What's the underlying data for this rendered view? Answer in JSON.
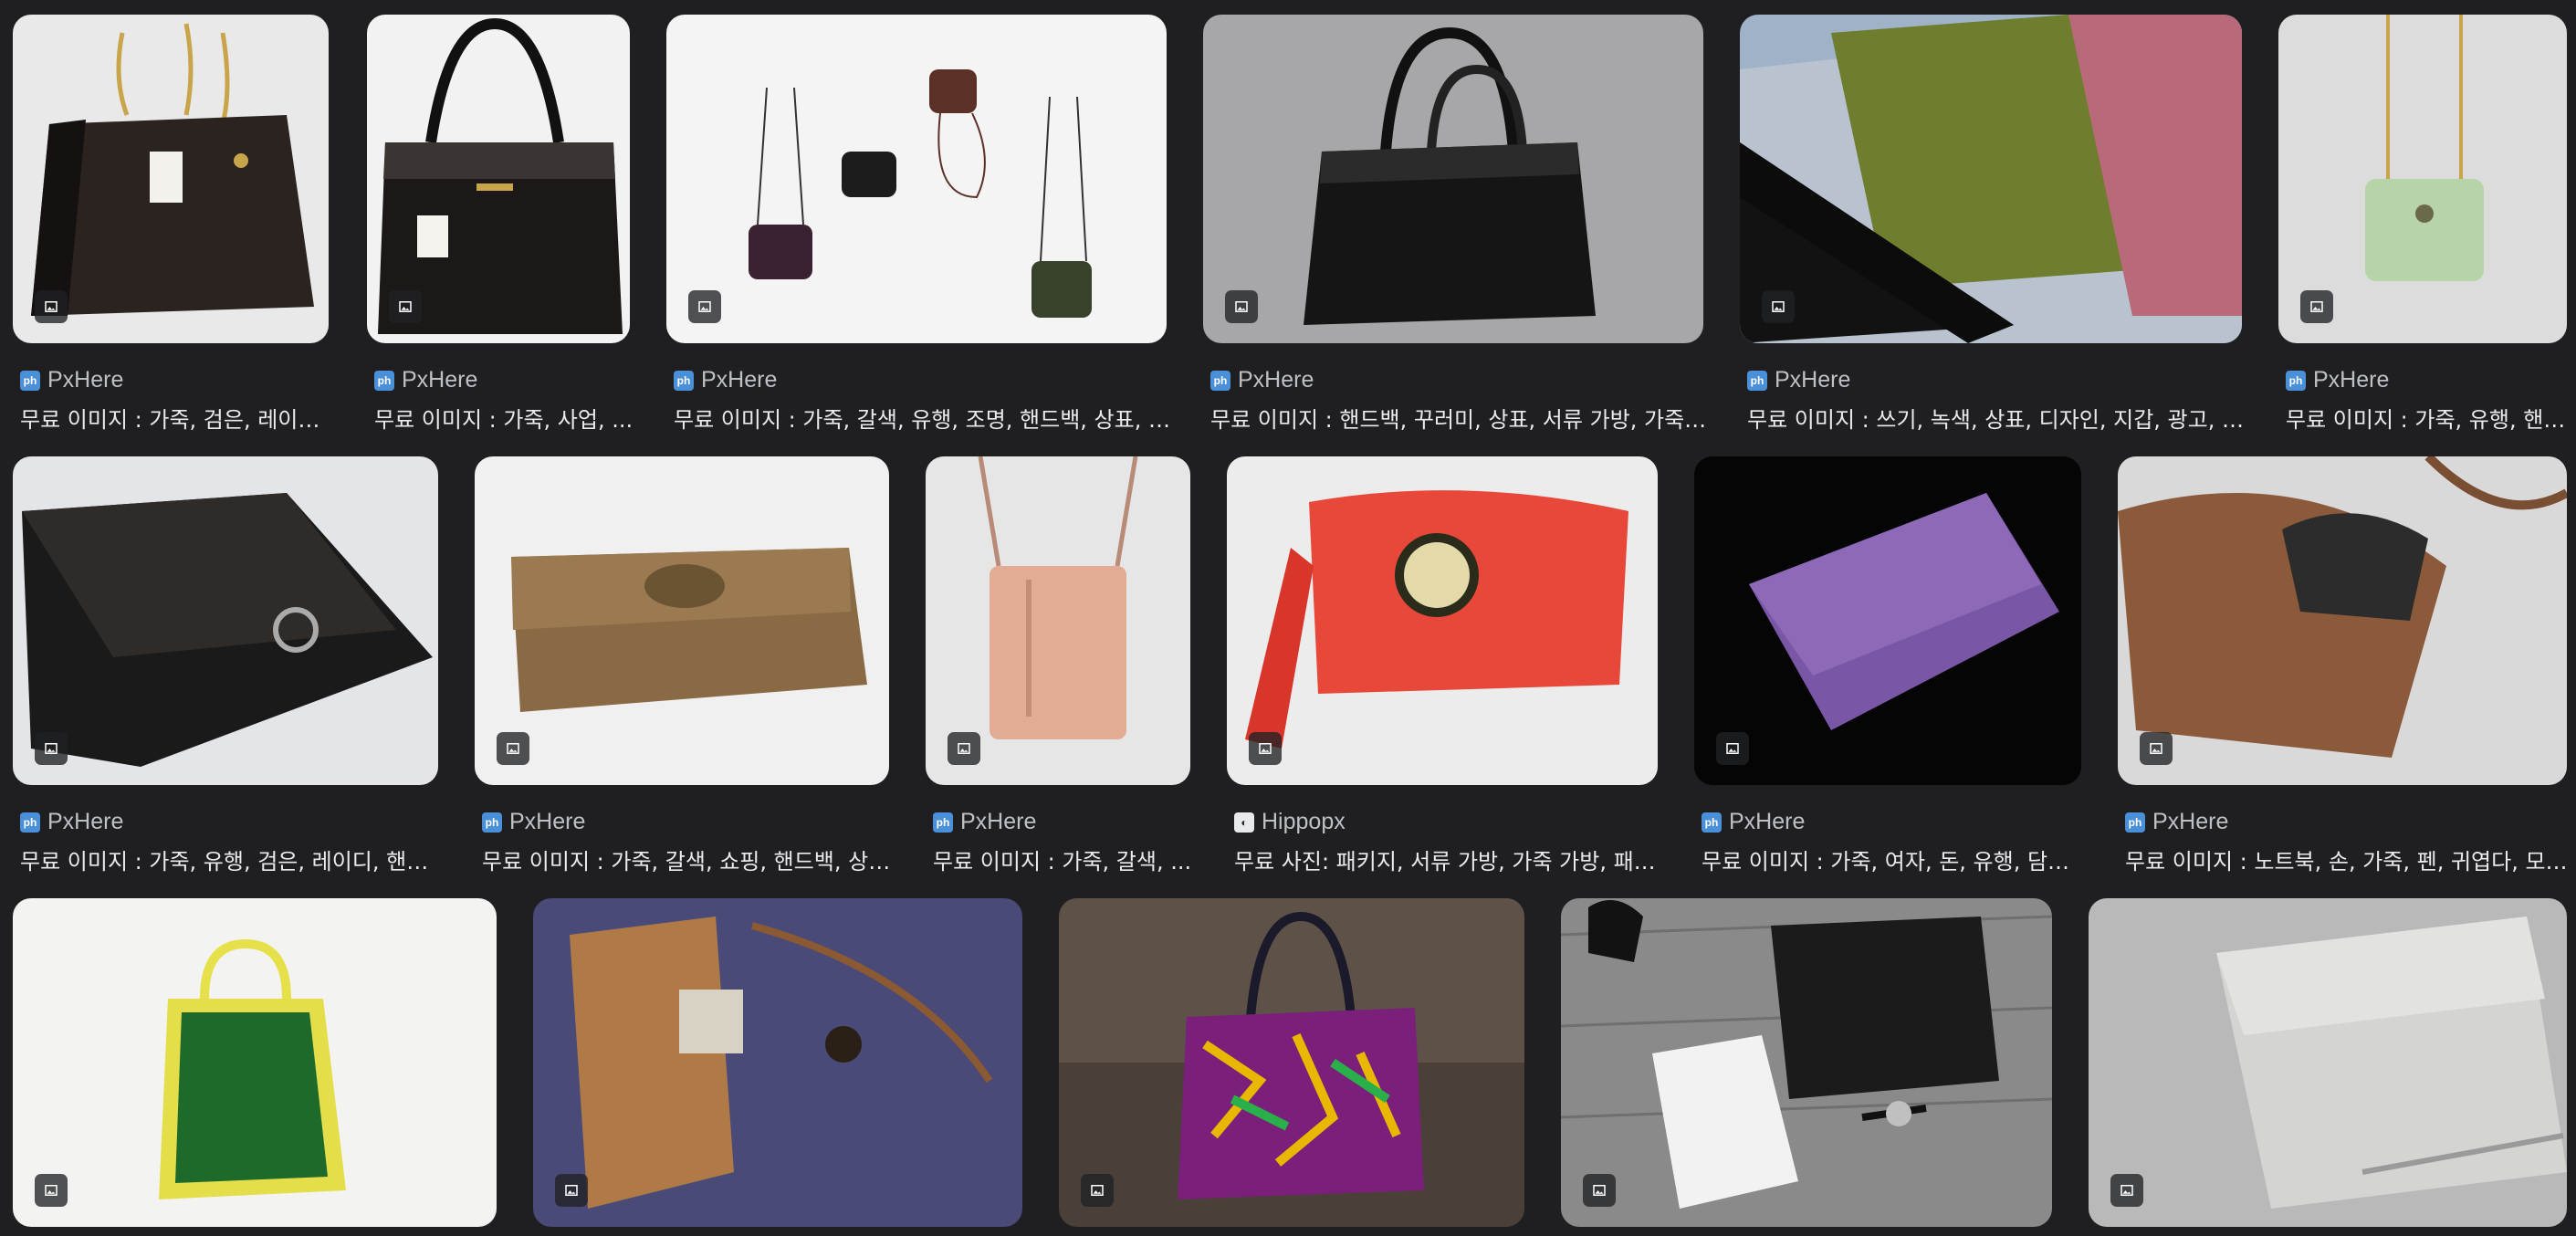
{
  "results": [
    {
      "source": "PxHere",
      "favicon": "ph",
      "caption": "무료 이미지 : 가죽, 검은, 레이디, ..."
    },
    {
      "source": "PxHere",
      "favicon": "ph",
      "caption": "무료 이미지 : 가죽, 사업, ..."
    },
    {
      "source": "PxHere",
      "favicon": "ph",
      "caption": "무료 이미지 : 가죽, 갈색, 유행, 조명, 핸드백, 상표, 생..."
    },
    {
      "source": "PxHere",
      "favicon": "ph",
      "caption": "무료 이미지 : 핸드백, 꾸러미, 상표, 서류 가방, 가죽 가..."
    },
    {
      "source": "PxHere",
      "favicon": "ph",
      "caption": "무료 이미지 : 쓰기, 녹색, 상표, 디자인, 지갑, 광고, 문서..."
    },
    {
      "source": "PxHere",
      "favicon": "ph",
      "caption": "무료 이미지 : 가죽, 유행, 핸드..."
    },
    {
      "source": "PxHere",
      "favicon": "ph",
      "caption": "무료 이미지 : 가죽, 유행, 검은, 레이디, 핸드백..."
    },
    {
      "source": "PxHere",
      "favicon": "ph",
      "caption": "무료 이미지 : 가죽, 갈색, 쇼핑, 핸드백, 상표, ..."
    },
    {
      "source": "PxHere",
      "favicon": "ph",
      "caption": "무료 이미지 : 가죽, 갈색, ..."
    },
    {
      "source": "Hippopx",
      "favicon": "hippo",
      "caption": "무료 사진: 패키지, 서류 가방, 가죽 가방, 패션, ..."
    },
    {
      "source": "PxHere",
      "favicon": "ph",
      "caption": "무료 이미지 : 가죽, 여자, 돈, 유행, 담홍색..."
    },
    {
      "source": "PxHere",
      "favicon": "ph",
      "caption": "무료 이미지 : 노트북, 손, 가죽, 펜, 귀엽다, 모델, ..."
    },
    {
      "source": "",
      "favicon": "",
      "caption": ""
    },
    {
      "source": "",
      "favicon": "",
      "caption": ""
    },
    {
      "source": "",
      "favicon": "",
      "caption": ""
    },
    {
      "source": "",
      "favicon": "",
      "caption": ""
    },
    {
      "source": "",
      "favicon": "",
      "caption": ""
    }
  ],
  "favicon_text": {
    "ph": "ph",
    "hippo": "◐"
  },
  "icons": {
    "image_badge": "image-icon"
  },
  "colors": {
    "page_bg": "#1f1f22",
    "source_text": "#bdc1c6",
    "caption_text": "#e8eaed"
  }
}
